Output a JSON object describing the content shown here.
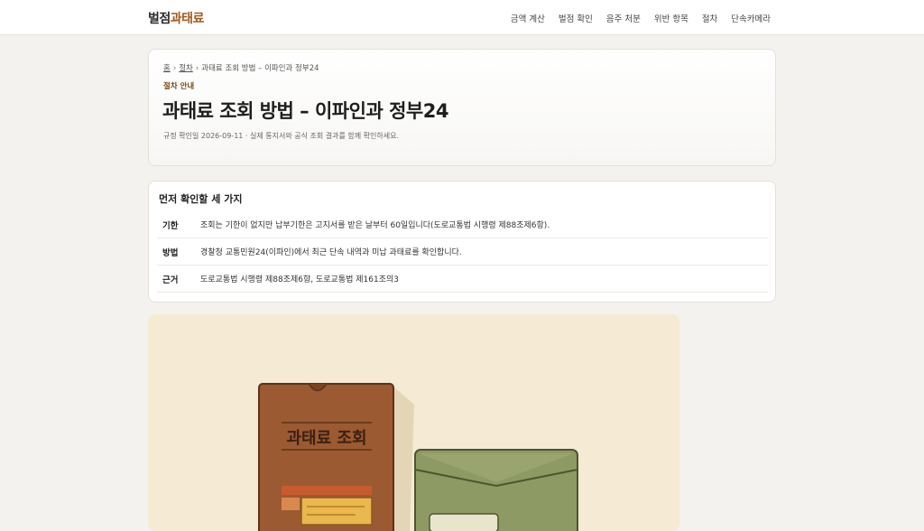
{
  "header": {
    "logo_part1": "벌점",
    "logo_part2": "과태료",
    "nav": [
      "금액 계산",
      "벌점 확인",
      "음주 처분",
      "위반 항목",
      "절차",
      "단속카메라"
    ]
  },
  "hero": {
    "breadcrumb": {
      "home": "홈",
      "section": "절차",
      "current": "과태료 조회 방법 – 이파인과 정부24",
      "separator": "›"
    },
    "eyebrow": "절차 안내",
    "title": "과태료 조회 방법 – 이파인과 정부24",
    "meta": "규정 확인일 2026-09-11 · 실제 통지서와 공식 조회 결과를 함께 확인하세요."
  },
  "summary": {
    "title": "먼저 확인할 세 가지",
    "rows": [
      {
        "key": "기한",
        "value": "조회는 기한이 없지만 납부기한은 고지서를 받은 날부터 60일입니다(도로교통법 시행령 제88조제6항)."
      },
      {
        "key": "방법",
        "value": "경찰청 교통민원24(이파인)에서 최근 단속 내역과 미납 과태료를 확인합니다."
      },
      {
        "key": "근거",
        "value": "도로교통법 시행령 제88조제6항, 도로교통법 제161조의3"
      }
    ]
  },
  "illustration": {
    "folder_label": "과태료 조회"
  },
  "colors": {
    "accent": "#a05a1c",
    "folder": "#9b5a32",
    "envelope": "#8e9a63",
    "illustration_bg": "#f5ead4"
  }
}
